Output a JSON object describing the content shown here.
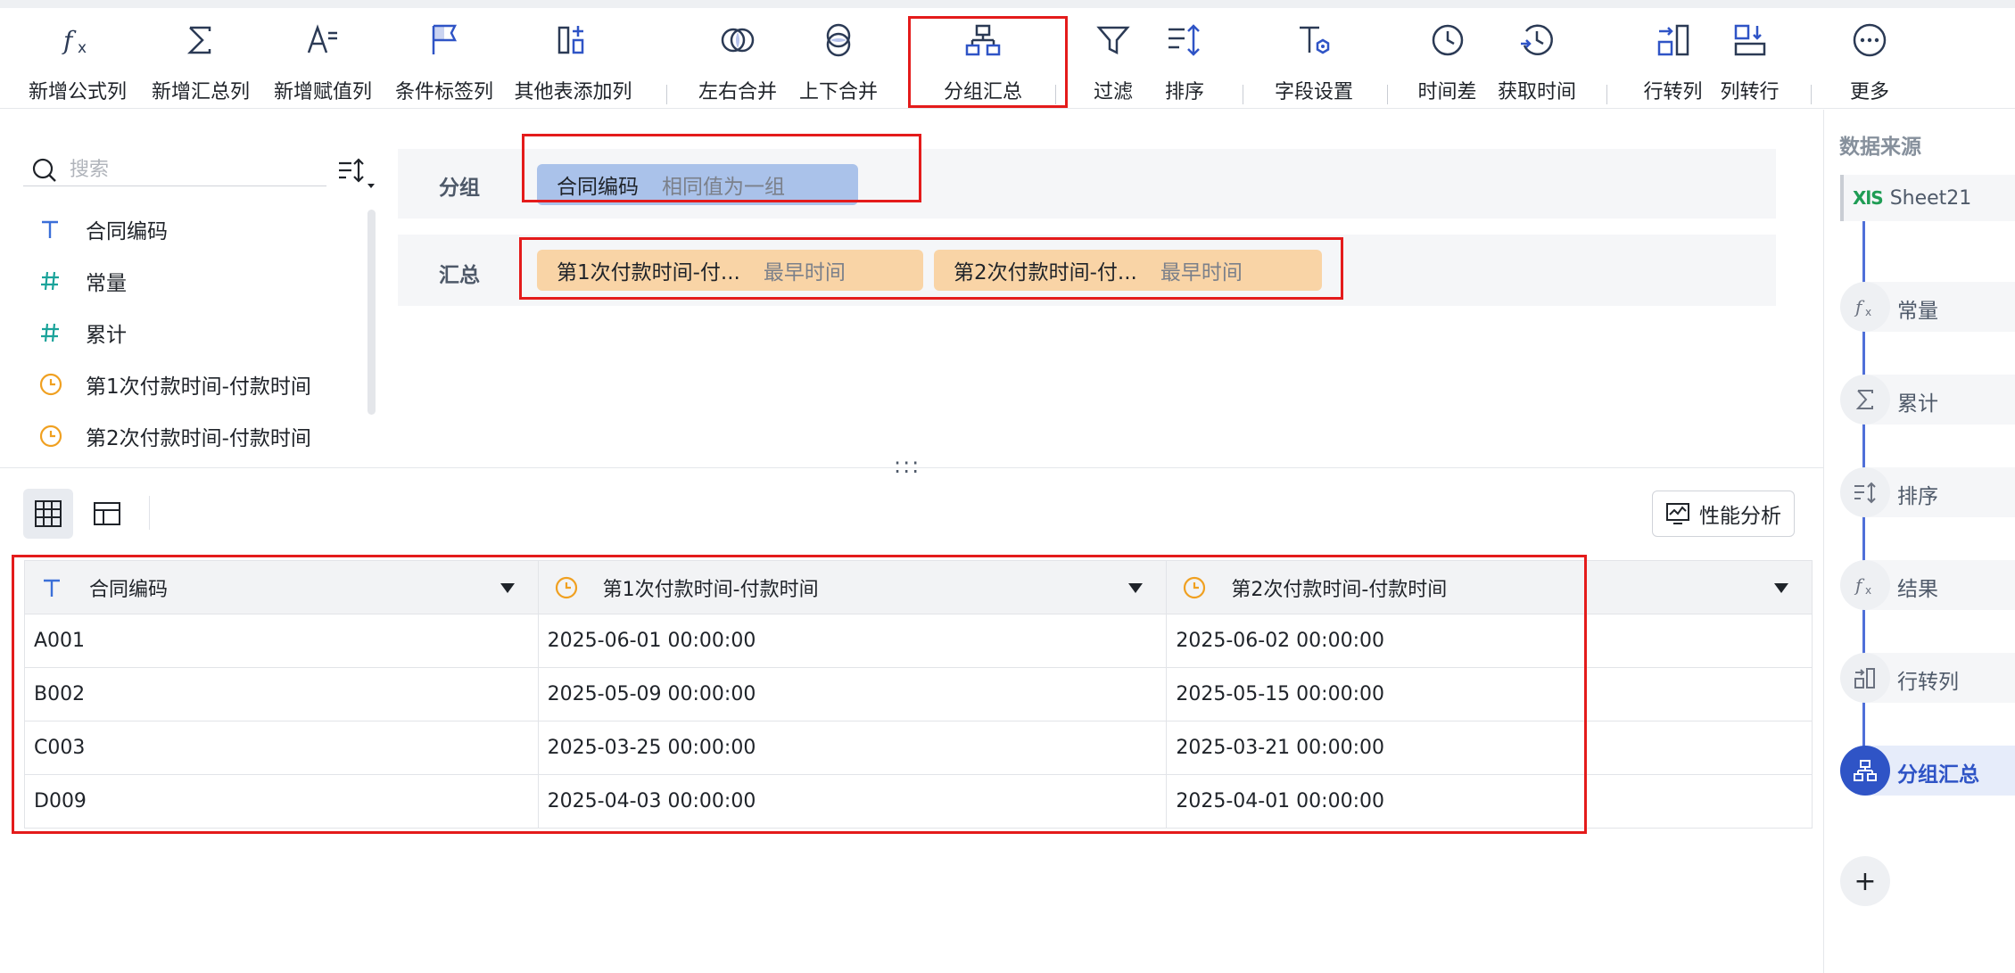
{
  "toolbar": {
    "items": [
      {
        "label": "新增公式列",
        "icon": "fx-icon"
      },
      {
        "label": "新增汇总列",
        "icon": "sigma-icon"
      },
      {
        "label": "新增赋值列",
        "icon": "assign-icon"
      },
      {
        "label": "条件标签列",
        "icon": "flag-icon"
      },
      {
        "label": "其他表添加列",
        "icon": "add-column-icon"
      },
      {
        "label": "左右合并",
        "icon": "merge-horizontal-icon"
      },
      {
        "label": "上下合并",
        "icon": "merge-vertical-icon"
      },
      {
        "label": "分组汇总",
        "icon": "group-summary-icon"
      },
      {
        "label": "过滤",
        "icon": "filter-icon"
      },
      {
        "label": "排序",
        "icon": "sort-icon"
      },
      {
        "label": "字段设置",
        "icon": "field-settings-icon"
      },
      {
        "label": "时间差",
        "icon": "clock-icon"
      },
      {
        "label": "获取时间",
        "icon": "get-time-icon"
      },
      {
        "label": "行转列",
        "icon": "row-to-column-icon"
      },
      {
        "label": "列转行",
        "icon": "column-to-row-icon"
      },
      {
        "label": "更多",
        "icon": "more-icon"
      }
    ]
  },
  "search": {
    "placeholder": "搜索"
  },
  "fields": [
    {
      "label": "合同编码",
      "type": "text"
    },
    {
      "label": "常量",
      "type": "number"
    },
    {
      "label": "累计",
      "type": "number"
    },
    {
      "label": "第1次付款时间-付款时间",
      "type": "time"
    },
    {
      "label": "第2次付款时间-付款时间",
      "type": "time"
    }
  ],
  "config": {
    "group_label": "分组",
    "group_chip": {
      "name": "合同编码",
      "sub": "相同值为一组"
    },
    "summary_label": "汇总",
    "summary_chips": [
      {
        "name": "第1次付款时间-付...",
        "sub": "最早时间"
      },
      {
        "name": "第2次付款时间-付...",
        "sub": "最早时间"
      }
    ]
  },
  "drag_handle": ":::",
  "perf_button": "性能分析",
  "table": {
    "columns": [
      {
        "label": "合同编码",
        "type": "text"
      },
      {
        "label": "第1次付款时间-付款时间",
        "type": "time"
      },
      {
        "label": "第2次付款时间-付款时间",
        "type": "time"
      }
    ],
    "rows": [
      [
        "A001",
        "2025-06-01 00:00:00",
        "2025-06-02 00:00:00"
      ],
      [
        "B002",
        "2025-05-09 00:00:00",
        "2025-05-15 00:00:00"
      ],
      [
        "C003",
        "2025-03-25 00:00:00",
        "2025-03-21 00:00:00"
      ],
      [
        "D009",
        "2025-04-03 00:00:00",
        "2025-04-01 00:00:00"
      ]
    ]
  },
  "flow": {
    "title": "数据来源",
    "source": {
      "badge": "XlS",
      "name": "Sheet21"
    },
    "steps": [
      {
        "name": "常量",
        "icon": "fx-icon",
        "active": false
      },
      {
        "name": "累计",
        "icon": "sigma-icon",
        "active": false
      },
      {
        "name": "排序",
        "icon": "sort-icon",
        "active": false
      },
      {
        "name": "结果",
        "icon": "fx-icon",
        "active": false
      },
      {
        "name": "行转列",
        "icon": "row-to-column-icon",
        "active": false
      },
      {
        "name": "分组汇总",
        "icon": "group-summary-icon",
        "active": true
      }
    ],
    "add": "+"
  },
  "colors": {
    "accent": "#2f54c6",
    "highlight": "#e41b1b",
    "chip_blue": "#aac2ea",
    "chip_orange": "#f9d4a6",
    "time_icon": "#f0a020",
    "number_icon": "#1aa39a"
  }
}
